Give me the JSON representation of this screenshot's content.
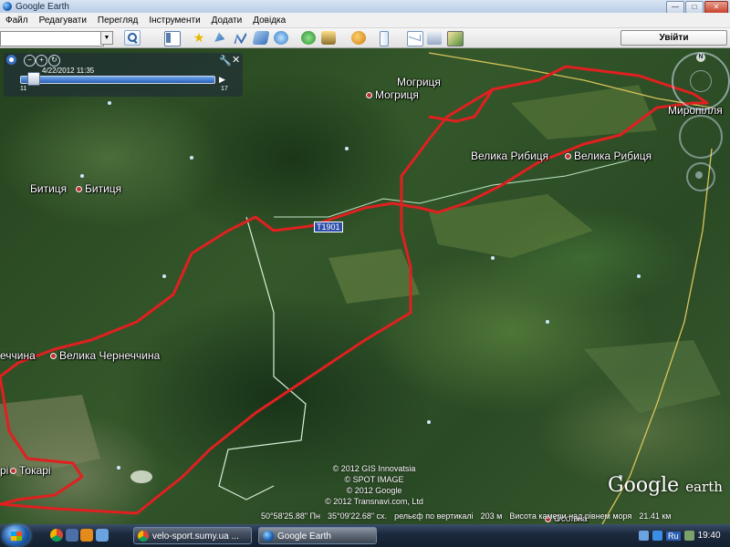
{
  "window": {
    "title": "Google Earth",
    "buttons": {
      "minimize": "—",
      "maximize": "□",
      "close": "✕"
    }
  },
  "menu": [
    "Файл",
    "Редагувати",
    "Перегляд",
    "Інструменти",
    "Додати",
    "Довідка"
  ],
  "toolbar": {
    "search_value": "",
    "login": "Увійти",
    "icons": [
      "sidebar-icon",
      "placemark-icon",
      "polygon-icon",
      "path-icon",
      "image-overlay-icon",
      "record-tour-icon",
      "historical-imagery-icon",
      "sunlight-icon",
      "planets-icon",
      "ruler-icon",
      "email-icon",
      "print-icon",
      "view-in-maps-icon"
    ]
  },
  "time_slider": {
    "date": "4/22/2012 11:35",
    "start": "11",
    "end": "17"
  },
  "places": [
    {
      "name": "Могриця",
      "kind": "label"
    },
    {
      "name": "Могриця",
      "kind": "dot"
    },
    {
      "name": "Миропілля",
      "kind": "label"
    },
    {
      "name": "Велика Рибиця",
      "kind": "label"
    },
    {
      "name": "Велика Рибиця",
      "kind": "dot"
    },
    {
      "name": "Битиця",
      "kind": "label"
    },
    {
      "name": "Битиця",
      "kind": "dot"
    },
    {
      "name": "еччина",
      "kind": "label"
    },
    {
      "name": "Велика Чернеччина",
      "kind": "dot"
    },
    {
      "name": "рі",
      "kind": "label"
    },
    {
      "name": "Токарі",
      "kind": "dot"
    },
    {
      "name": "Осоївка",
      "kind": "dot"
    }
  ],
  "road_label": "T1901",
  "copyright": [
    "© 2012 GIS Innovatsia",
    "© SPOT IMAGE",
    "© 2012 Google",
    "© 2012 Transnavi.com, Ltd"
  ],
  "logo": {
    "google": "Google",
    "earth": "earth"
  },
  "status": {
    "lat": "50°58'25.88\" Пн",
    "lon": "35°09'22.68\" сх.",
    "relief": "рельєф по вертикалі",
    "elev": "203 м",
    "camera": "Висота камери над рівнем моря",
    "alt": "21.41 км"
  },
  "taskbar": {
    "tasks": [
      "velo-sport.sumy.ua ...",
      "Google Earth"
    ],
    "lang": "Ru",
    "time": "19:40"
  }
}
